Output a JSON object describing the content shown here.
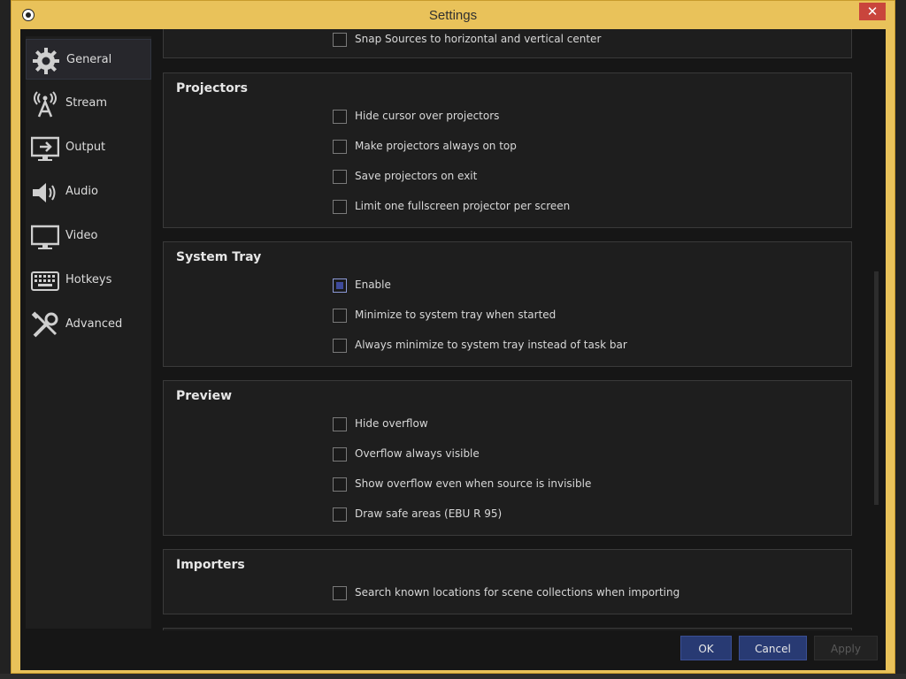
{
  "window": {
    "title": "Settings",
    "close_glyph": "✕"
  },
  "sidebar": {
    "items": [
      {
        "label": "General",
        "icon": "gear-icon",
        "active": true
      },
      {
        "label": "Stream",
        "icon": "broadcast-antenna-icon"
      },
      {
        "label": "Output",
        "icon": "output-monitor-icon"
      },
      {
        "label": "Audio",
        "icon": "speaker-icon"
      },
      {
        "label": "Video",
        "icon": "monitor-icon"
      },
      {
        "label": "Hotkeys",
        "icon": "keyboard-icon"
      },
      {
        "label": "Advanced",
        "icon": "tools-icon"
      }
    ]
  },
  "top_partial": {
    "label": "Snap Sources to horizontal and vertical center",
    "checked": false
  },
  "groups": [
    {
      "title": "Projectors",
      "options": [
        {
          "label": "Hide cursor over projectors",
          "checked": false
        },
        {
          "label": "Make projectors always on top",
          "checked": false
        },
        {
          "label": "Save projectors on exit",
          "checked": false
        },
        {
          "label": "Limit one fullscreen projector per screen",
          "checked": false
        }
      ]
    },
    {
      "title": "System Tray",
      "options": [
        {
          "label": "Enable",
          "checked": true
        },
        {
          "label": "Minimize to system tray when started",
          "checked": false
        },
        {
          "label": "Always minimize to system tray instead of task bar",
          "checked": false
        }
      ]
    },
    {
      "title": "Preview",
      "options": [
        {
          "label": "Hide overflow",
          "checked": false
        },
        {
          "label": "Overflow always visible",
          "checked": false
        },
        {
          "label": "Show overflow even when source is invisible",
          "checked": false
        },
        {
          "label": "Draw safe areas (EBU R 95)",
          "checked": false
        }
      ]
    },
    {
      "title": "Importers",
      "options": [
        {
          "label": "Search known locations for scene collections when importing",
          "checked": false
        }
      ]
    }
  ],
  "buttons": {
    "ok": "OK",
    "cancel": "Cancel",
    "apply": "Apply"
  },
  "colors": {
    "title_bar": "#e9c25a",
    "accent_button": "#283a73",
    "close_button": "#c9453c"
  }
}
